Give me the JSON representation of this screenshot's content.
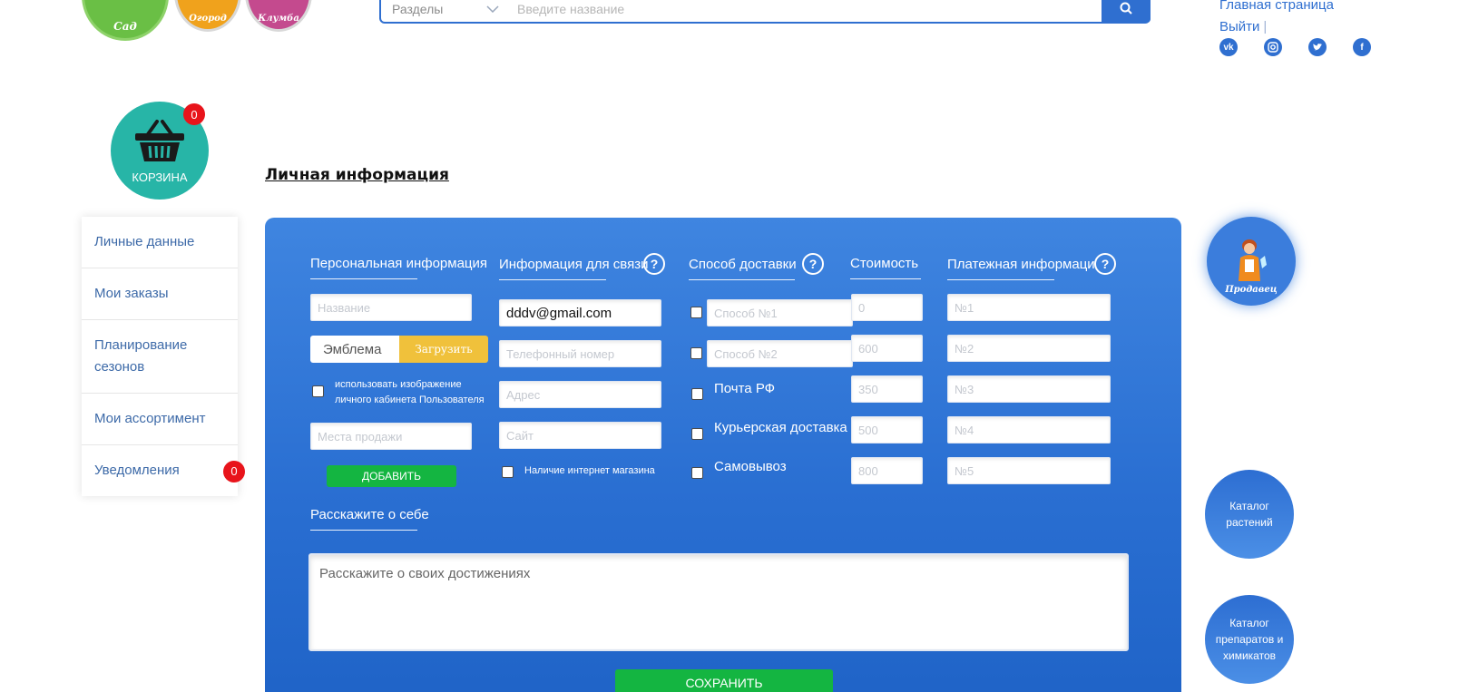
{
  "header": {
    "logos": [
      "Сад",
      "Огород",
      "Клумба"
    ],
    "search": {
      "sections_label": "Разделы",
      "placeholder": "Введите название"
    },
    "links": {
      "home": "Главная страница",
      "logout": "Выйти",
      "separator": "|"
    },
    "socials": [
      "vk-icon",
      "instagram-icon",
      "twitter-icon",
      "facebook-icon"
    ]
  },
  "basket": {
    "label": "КОРЗИНА",
    "count": "0"
  },
  "sidebar": {
    "items": [
      {
        "label": "Личные данные"
      },
      {
        "label": "Мои заказы"
      },
      {
        "label": "Планирование сезонов"
      },
      {
        "label": "Мои ассортимент"
      },
      {
        "label": "Уведомления",
        "badge": "0"
      }
    ]
  },
  "page_title": "Личная информация",
  "personal": {
    "title": "Персональная информация",
    "name_placeholder": "Название",
    "emblem_label": "Эмблема",
    "upload_label": "Загрузить",
    "use_image_label": "использовать изображение личного кабинета Пользователя",
    "places_placeholder": "Места продажи",
    "add_label": "ДОБАВИТЬ"
  },
  "contact": {
    "title": "Информация для связи",
    "email_value": "dddv@gmail.com",
    "phone_placeholder": "Телефонный номер",
    "address_placeholder": "Адрес",
    "site_placeholder": "Сайт",
    "online_store_label": "Наличие интернет магазина"
  },
  "delivery": {
    "title": "Способ доставки",
    "method1_placeholder": "Способ №1",
    "method2_placeholder": "Способ №2",
    "options": [
      "Почта РФ",
      "Курьерская доставка",
      "Самовывоз"
    ]
  },
  "cost": {
    "title": "Стоимость",
    "placeholders": [
      "0",
      "600",
      "350",
      "500",
      "800"
    ]
  },
  "payment": {
    "title": "Платежная информаци",
    "placeholders": [
      "№1",
      "№2",
      "№3",
      "№4",
      "№5"
    ]
  },
  "about": {
    "title": "Расскажите о себе",
    "placeholder": "Расскажите о своих достижениях"
  },
  "save_label": "СОХРАНИТЬ",
  "help_icon_text": "?",
  "right": {
    "seller_label": "Продавец",
    "catalog_plants": "Каталог растений",
    "catalog_chemicals": "Каталог препаратов и химикатов"
  }
}
